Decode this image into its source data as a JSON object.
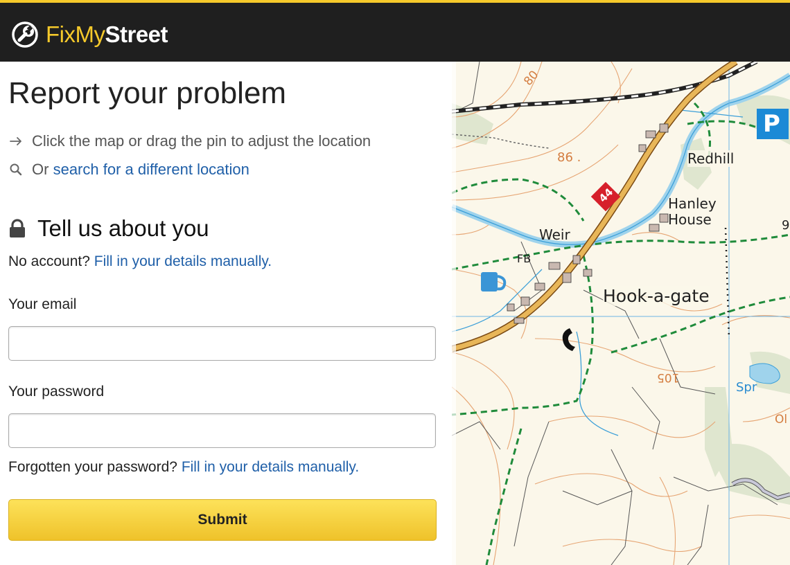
{
  "header": {
    "brand_fix": "FixMy",
    "brand_street": "Street",
    "logo_icon": "wrench-circle-icon",
    "accent": "#f5c92b",
    "bar_color": "#1f1f1f"
  },
  "main": {
    "title": "Report your problem",
    "hint_adjust": "Click the map or drag the pin to adjust the location",
    "hint_search_prefix": "Or",
    "hint_search_link": "search for a different location",
    "section_title": "Tell us about you",
    "no_account_text": "No account?",
    "no_account_link": "Fill in your details manually.",
    "email_label": "Your email",
    "email_value": "",
    "password_label": "Your password",
    "password_value": "",
    "forgot_text": "Forgotten your password?",
    "forgot_link": "Fill in your details manually.",
    "submit_label": "Submit",
    "link_color": "#1f5fa8"
  },
  "map": {
    "labels": {
      "contour_80": "80",
      "spot_86": "86 .",
      "road_number": "44",
      "redhill": "Redhill",
      "hanley_house": "Hanley House",
      "hanley": "Hanley",
      "house": "House",
      "weir": "Weir",
      "fb": "FB",
      "hook_a_gate": "Hook-a-gate",
      "contour_105": "105",
      "spr": "Spr",
      "edge_9": "9",
      "edge_ol": "Ol",
      "parking": "P"
    }
  }
}
